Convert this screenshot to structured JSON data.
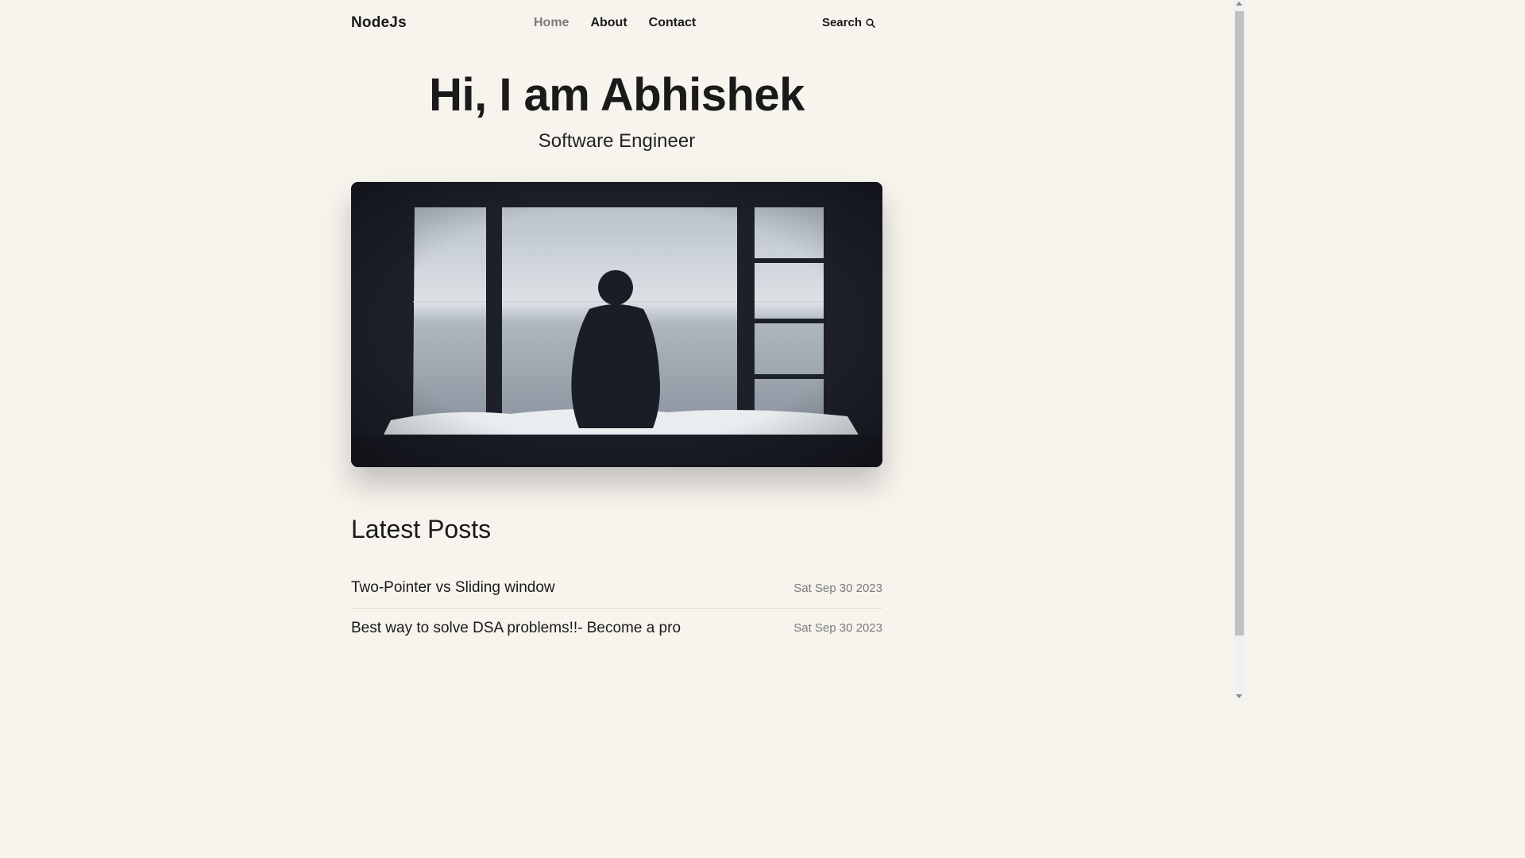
{
  "header": {
    "logo": "NodeJs",
    "nav": [
      {
        "label": "Home",
        "active": true
      },
      {
        "label": "About",
        "active": false
      },
      {
        "label": "Contact",
        "active": false
      }
    ],
    "search_label": "Search"
  },
  "hero": {
    "title": "Hi, I am Abhishek",
    "subtitle": "Software Engineer"
  },
  "latest_posts": {
    "heading": "Latest Posts",
    "items": [
      {
        "title": "Two-Pointer vs Sliding window",
        "date": "Sat Sep 30 2023"
      },
      {
        "title": "Best way to solve DSA problems!!- Become a pro",
        "date": "Sat Sep 30 2023"
      }
    ]
  },
  "colors": {
    "background": "#f7f4ee",
    "text": "#1a1a1a",
    "muted": "#7a7a7a"
  }
}
